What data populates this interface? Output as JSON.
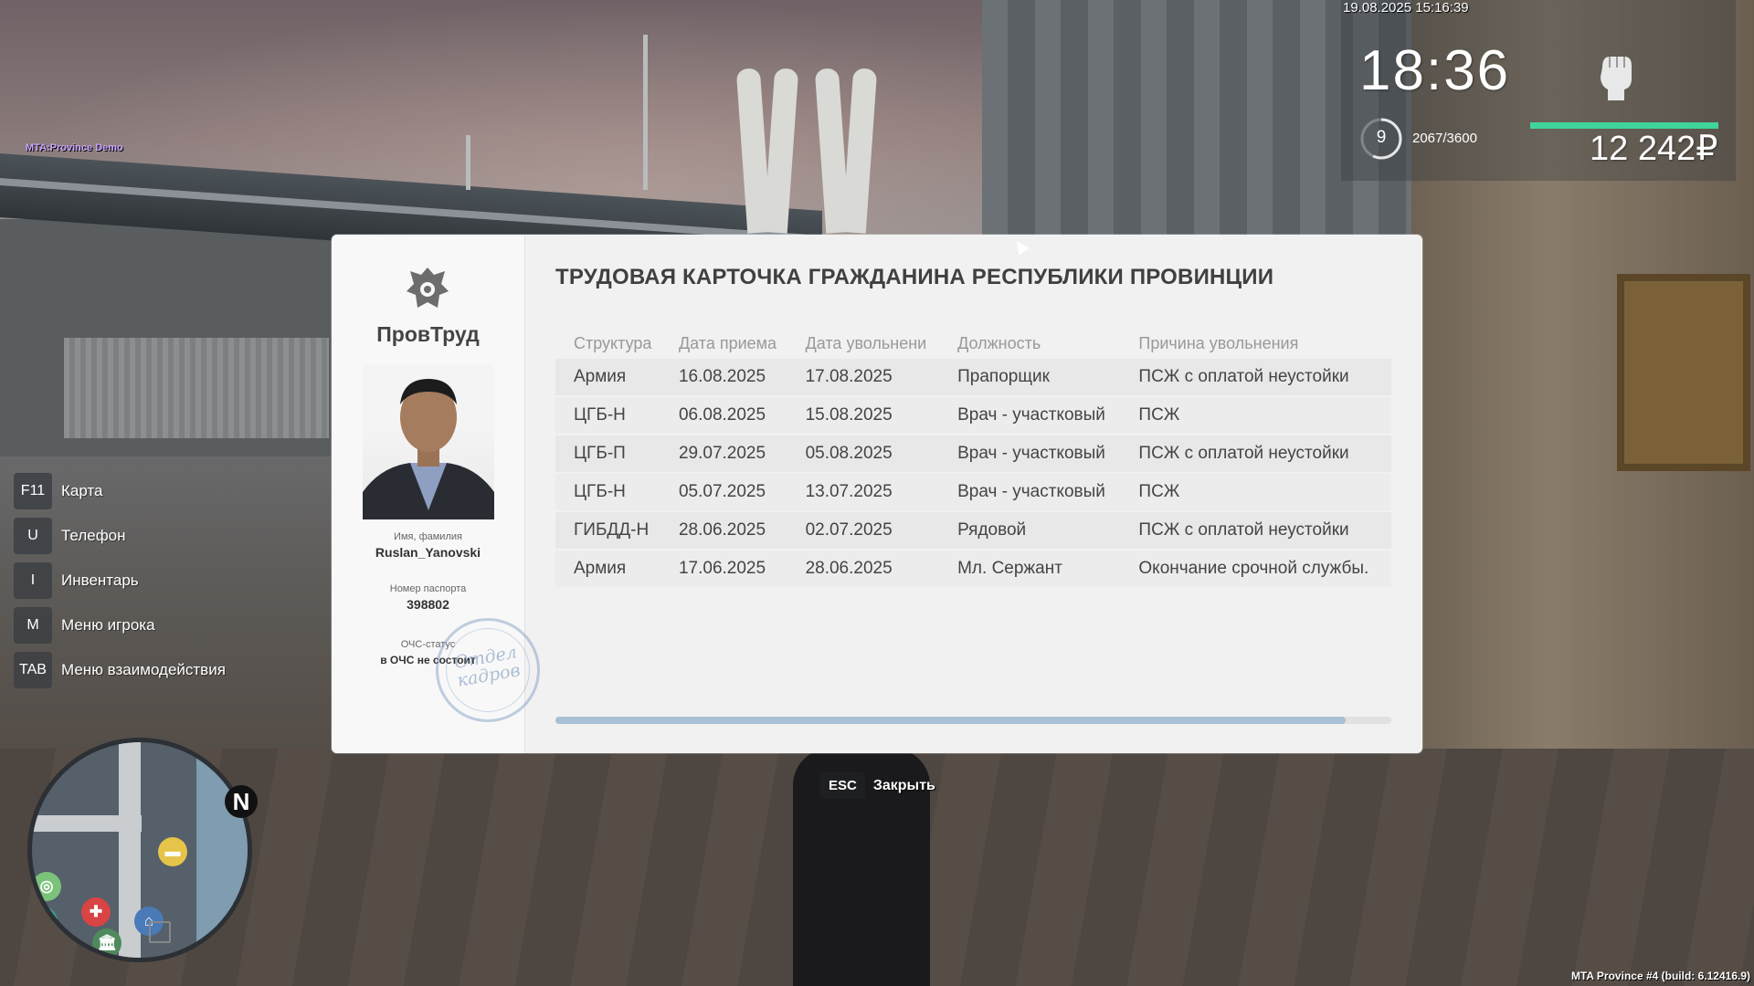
{
  "hud": {
    "server_name": "MTA:Province Demo",
    "build_info": "MTA Province #4 (build: 6.12416.9)",
    "datetime": "19.08.2025 15:16:39",
    "clock": "18:36",
    "level": "9",
    "experience": "2067/3600",
    "money": "12 242₽",
    "icons": {
      "status": "fist-icon",
      "level_ring": "level-ring-icon"
    },
    "colors": {
      "money_bar": "#3fd49b"
    }
  },
  "hints": [
    {
      "key": "F11",
      "label": "Карта"
    },
    {
      "key": "U",
      "label": "Телефон"
    },
    {
      "key": "I",
      "label": "Инвентарь"
    },
    {
      "key": "M",
      "label": "Меню игрока"
    },
    {
      "key": "TAB",
      "label": "Меню взаимодействия"
    }
  ],
  "minimap": {
    "north_label": "N",
    "icons": [
      "target-icon",
      "car-icon",
      "hospital-icon",
      "taxi-icon",
      "home-icon",
      "bank-icon"
    ]
  },
  "card": {
    "organization": "ПровТруд",
    "title": "ТРУДОВАЯ КАРТОЧКА ГРАЖДАНИНА РЕСПУБЛИКИ ПРОВИНЦИИ",
    "name_label": "Имя, фамилия",
    "name_value": "Ruslan_Yanovski",
    "passport_label": "Номер паспорта",
    "passport_value": "398802",
    "status_label": "ОЧС-статус",
    "status_value": "в ОЧС не состоит",
    "stamp_text": "Отдел кадров",
    "columns": [
      "Структура",
      "Дата приема",
      "Дата увольнени",
      "Должность",
      "Причина увольнения"
    ],
    "rows": [
      [
        "Армия",
        "16.08.2025",
        "17.08.2025",
        "Прапорщик",
        "ПСЖ с оплатой неустойки"
      ],
      [
        "ЦГБ-Н",
        "06.08.2025",
        "15.08.2025",
        "Врач - участковый",
        "ПСЖ"
      ],
      [
        "ЦГБ-П",
        "29.07.2025",
        "05.08.2025",
        "Врач - участковый",
        "ПСЖ с оплатой неустойки"
      ],
      [
        "ЦГБ-Н",
        "05.07.2025",
        "13.07.2025",
        "Врач - участковый",
        "ПСЖ"
      ],
      [
        "ГИБДД-Н",
        "28.06.2025",
        "02.07.2025",
        "Рядовой",
        "ПСЖ с оплатой неустойки"
      ],
      [
        "Армия",
        "17.06.2025",
        "28.06.2025",
        "Мл. Сержант",
        "Окончание срочной службы."
      ]
    ],
    "scroll_fraction": 0.945,
    "close_key": "ESC",
    "close_label": "Закрыть"
  }
}
